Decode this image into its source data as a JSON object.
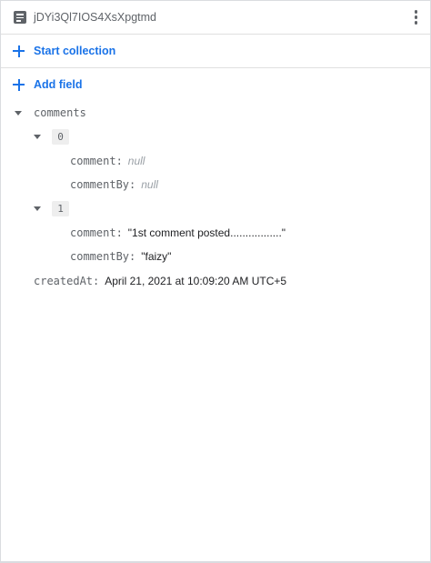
{
  "document": {
    "id": "jDYi3Ql7IOS4XsXpgtmd",
    "icon": "document-icon",
    "menu_icon": "more-vert-icon"
  },
  "actions": {
    "start_collection": "Start collection",
    "add_field": "Add field",
    "icon": "plus-icon",
    "color": "#1a73e8"
  },
  "fields": {
    "comments": {
      "key": "comments",
      "items": [
        {
          "index": "0",
          "comment_key": "comment:",
          "comment_value": "null",
          "commentBy_key": "commentBy:",
          "commentBy_value": "null"
        },
        {
          "index": "1",
          "comment_key": "comment:",
          "comment_value": "\"1st comment posted.................\"",
          "commentBy_key": "commentBy:",
          "commentBy_value": "\"faizy\""
        }
      ]
    },
    "createdAt": {
      "key": "createdAt:",
      "value": "April 21, 2021 at 10:09:20 AM UTC+5"
    }
  }
}
